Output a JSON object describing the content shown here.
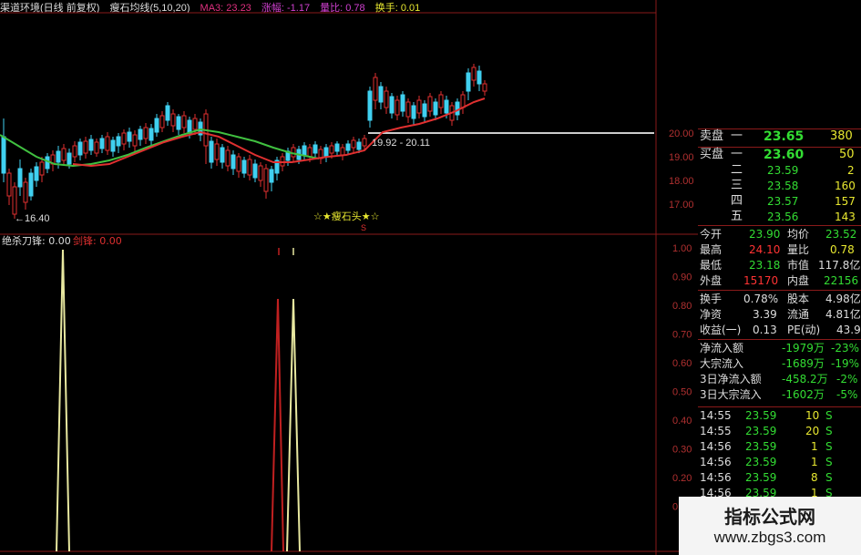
{
  "header": {
    "title": "渠道环境(日线 前复权)",
    "ma_label": "瘦石均线(5,10,20)",
    "ma3": "MA3: 23.23",
    "change": "涨幅: -1.17",
    "vol_ratio": "量比: 0.78",
    "turnover": "换手: 0.01"
  },
  "price_axis": [
    "20.00",
    "19.00",
    "18.00",
    "17.00"
  ],
  "indicator_axis": [
    "1.00",
    "0.90",
    "0.80",
    "0.70",
    "0.60",
    "0.50",
    "0.40",
    "0.30",
    "0.20",
    "0.10"
  ],
  "annotations": {
    "low": "←16.40",
    "range": "19.92 - 20.11",
    "pattern": "☆★瘦石头★☆",
    "marker": "S"
  },
  "indicator_header": {
    "name": "绝杀",
    "blade": "刀锋: 0.00",
    "kill": "剑锋: 0.00"
  },
  "order_book": {
    "sell": [
      {
        "label": "卖盘",
        "level": "一",
        "price": "23.65",
        "vol": "380"
      }
    ],
    "buy": [
      {
        "label": "买盘",
        "level": "一",
        "price": "23.60",
        "vol": "50"
      },
      {
        "label": "",
        "level": "二",
        "price": "23.59",
        "vol": "2"
      },
      {
        "label": "",
        "level": "三",
        "price": "23.58",
        "vol": "160"
      },
      {
        "label": "",
        "level": "四",
        "price": "23.57",
        "vol": "157"
      },
      {
        "label": "",
        "level": "五",
        "price": "23.56",
        "vol": "143"
      }
    ]
  },
  "quote": [
    {
      "k1": "今开",
      "v1": "23.90",
      "k2": "均价",
      "v2": "23.52"
    },
    {
      "k1": "最高",
      "v1": "24.10",
      "k2": "量比",
      "v2": "0.78"
    },
    {
      "k1": "最低",
      "v1": "23.18",
      "k2": "市值",
      "v2": "117.8亿"
    },
    {
      "k1": "外盘",
      "v1": "15170",
      "k2": "内盘",
      "v2": "22156"
    }
  ],
  "fundamentals": [
    {
      "k1": "换手",
      "v1": "0.78%",
      "k2": "股本",
      "v2": "4.98亿"
    },
    {
      "k1": "净资",
      "v1": "3.39",
      "k2": "流通",
      "v2": "4.81亿"
    },
    {
      "k1": "收益(一)",
      "v1": "0.13",
      "k2": "PE(动)",
      "v2": "43.9"
    }
  ],
  "flows": [
    {
      "label": "净流入额",
      "value": "-1979万",
      "pct": "-23%"
    },
    {
      "label": "大宗流入",
      "value": "-1689万",
      "pct": "-19%"
    },
    {
      "label": "3日净流入额",
      "value": "-458.2万",
      "pct": "-2%"
    },
    {
      "label": "3日大宗流入",
      "value": "-1602万",
      "pct": "-5%"
    }
  ],
  "ticks": [
    {
      "time": "14:55",
      "price": "23.59",
      "vol": "10",
      "side": "S"
    },
    {
      "time": "14:55",
      "price": "23.59",
      "vol": "20",
      "side": "S"
    },
    {
      "time": "14:56",
      "price": "23.59",
      "vol": "1",
      "side": "S"
    },
    {
      "time": "14:56",
      "price": "23.59",
      "vol": "1",
      "side": "S"
    },
    {
      "time": "14:56",
      "price": "23.59",
      "vol": "8",
      "side": "S"
    },
    {
      "time": "14:56",
      "price": "23.59",
      "vol": "1",
      "side": "S"
    }
  ],
  "watermark": {
    "line1": "指标公式网",
    "line2": "www.zbgs3.com"
  },
  "colors": {
    "up": "#e03030",
    "down": "#40d0f0",
    "ma_short": "#40c040",
    "ma_long": "#e03030",
    "green_text": "#33dd33",
    "red_text": "#ff3333",
    "yellow": "#e8e830"
  }
}
